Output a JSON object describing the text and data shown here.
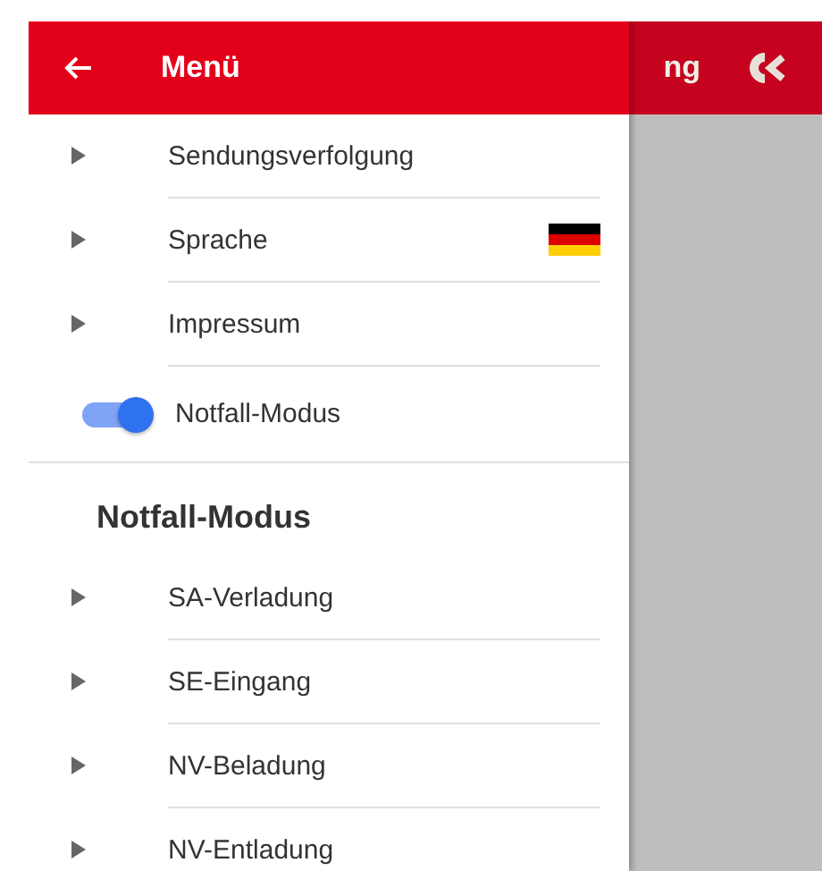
{
  "background_app": {
    "title_fragment": "ng"
  },
  "drawer": {
    "title": "Menü"
  },
  "menu_items": [
    {
      "kind": "link",
      "label": "Sendungsverfolgung"
    },
    {
      "kind": "language",
      "label": "Sprache"
    },
    {
      "kind": "link",
      "label": "Impressum"
    },
    {
      "kind": "toggle",
      "label": "Notfall-Modus",
      "on": true
    }
  ],
  "section": {
    "title": "Notfall-Modus",
    "items": [
      {
        "label": "SA-Verladung"
      },
      {
        "label": "SE-Eingang"
      },
      {
        "label": "NV-Beladung"
      },
      {
        "label": "NV-Entladung"
      }
    ]
  }
}
